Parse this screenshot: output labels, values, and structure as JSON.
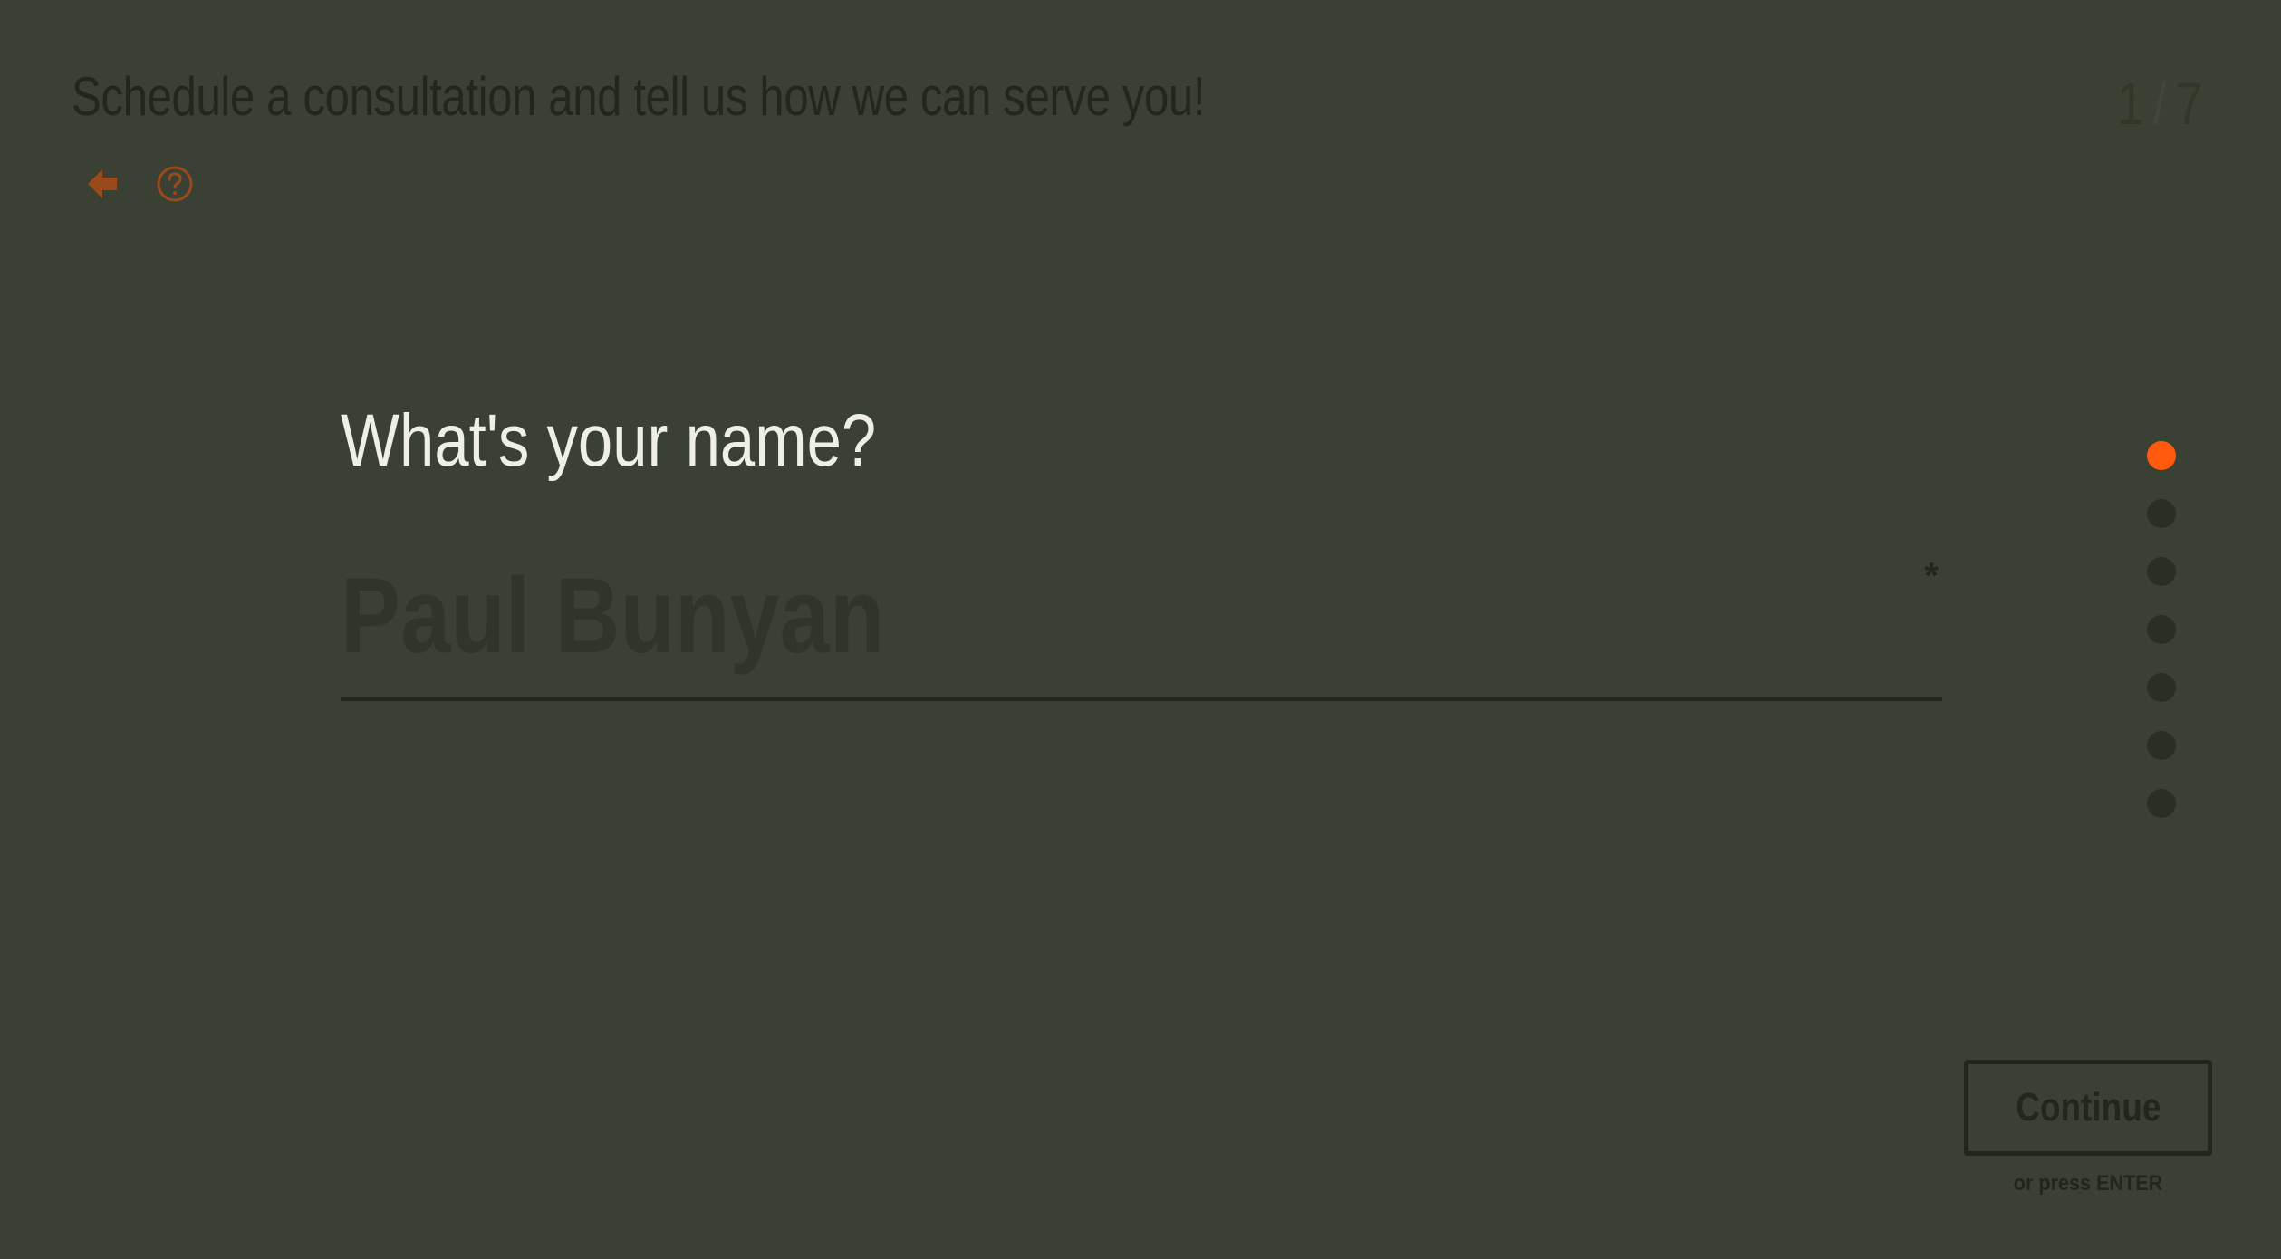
{
  "header": {
    "title": "Schedule a consultation and tell us how we can serve you!",
    "step_current": "1",
    "step_separator": "/",
    "step_total": "7"
  },
  "nav": {
    "back_icon": "arrow-left-icon",
    "help_icon": "question-circle-icon"
  },
  "form": {
    "question": "What's your name?",
    "name_value": "",
    "name_placeholder": "Paul Bunyan",
    "required_marker": "*"
  },
  "progress": {
    "total_steps": 7,
    "active_index": 0
  },
  "actions": {
    "continue_label": "Continue",
    "enter_hint": "or press ENTER"
  },
  "colors": {
    "background": "#3a4033",
    "accent": "#ff5a0d",
    "muted": "#22261d",
    "text_light": "#eef0e6"
  }
}
